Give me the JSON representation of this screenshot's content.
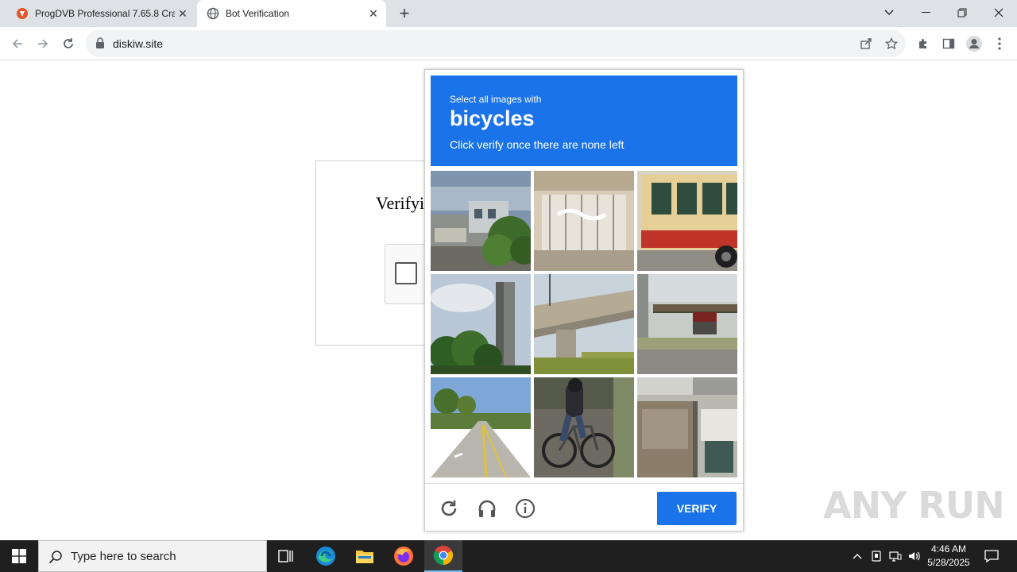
{
  "browser": {
    "tabs": [
      {
        "title": "ProgDVB Professional 7.65.8 Cra",
        "active": false,
        "favicon": "progdvb-icon"
      },
      {
        "title": "Bot Verification",
        "active": true,
        "favicon": "globe-icon"
      }
    ],
    "close_glyph": "✕",
    "new_tab_glyph": "+",
    "url": "diskiw.site"
  },
  "page": {
    "verify_title": "Verifyi"
  },
  "captcha": {
    "instruction_line1": "Select all images with",
    "target_object": "bicycles",
    "instruction_line3": "Click verify once there are none left",
    "tiles": [
      {
        "subject": "street with buildings and tree"
      },
      {
        "subject": "building entrance with glass"
      },
      {
        "subject": "bus"
      },
      {
        "subject": "tree and tall pillar"
      },
      {
        "subject": "highway overpass"
      },
      {
        "subject": "truck under overpass"
      },
      {
        "subject": "road with palm trees"
      },
      {
        "subject": "person riding bicycle"
      },
      {
        "subject": "building facade"
      }
    ],
    "verify_label": "VERIFY",
    "accent_color": "#1a73e8"
  },
  "watermark": "ANY RUN",
  "taskbar": {
    "search_placeholder": "Type here to search",
    "time": "4:46 AM",
    "date": "5/28/2025"
  }
}
